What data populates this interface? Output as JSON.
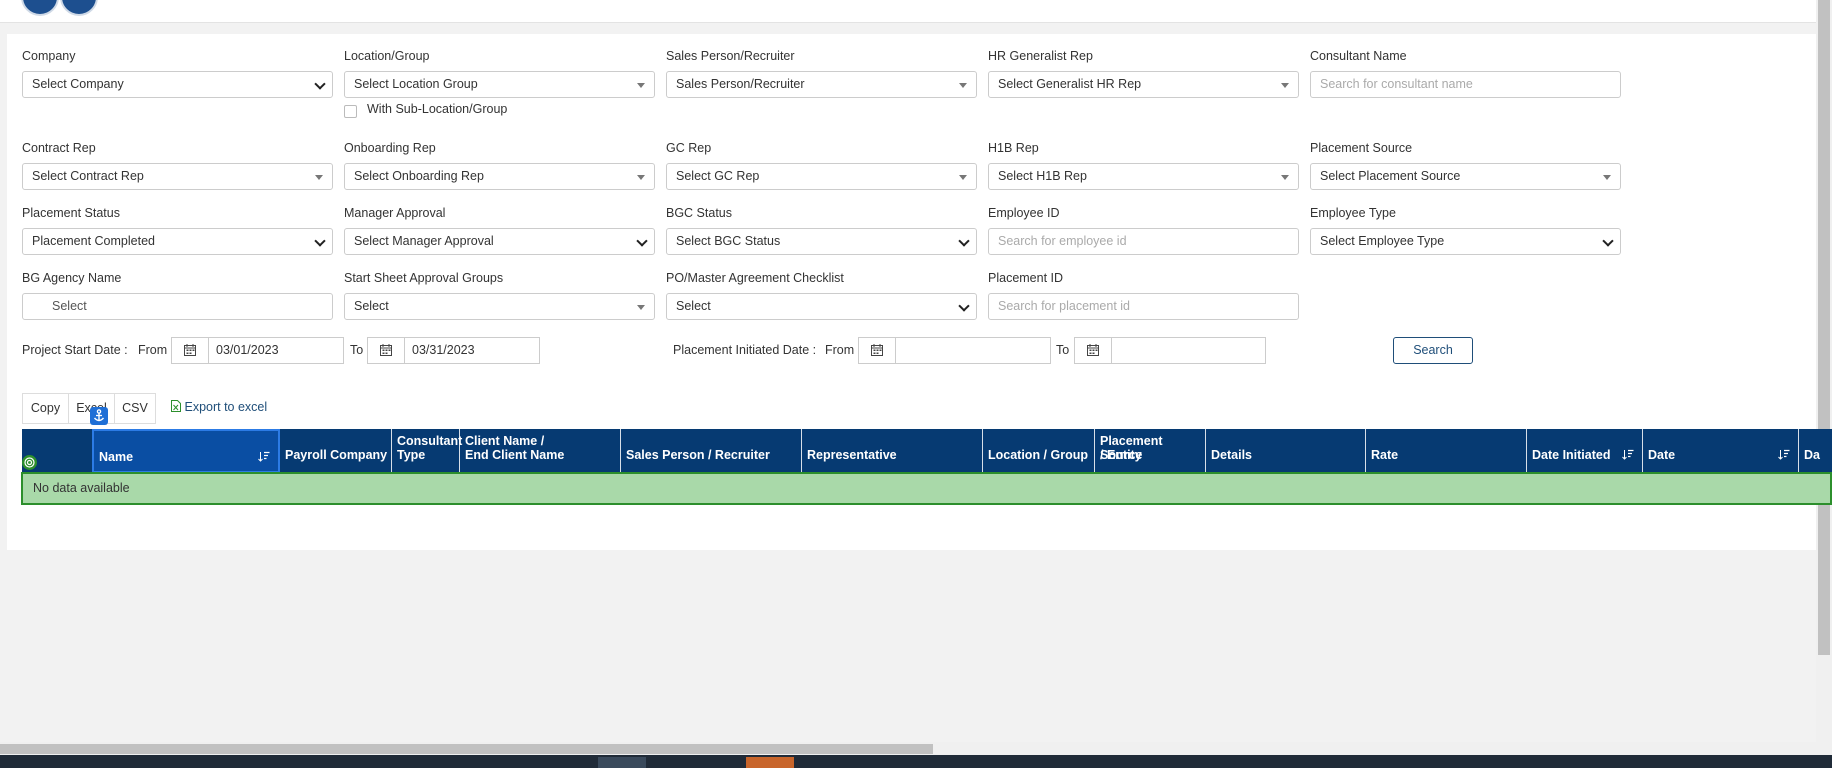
{
  "filters": {
    "company": {
      "label": "Company",
      "value": "Select Company"
    },
    "location_group": {
      "label": "Location/Group",
      "value": "Select Location Group",
      "checkbox_label": "With Sub-Location/Group"
    },
    "sales_person": {
      "label": "Sales Person/Recruiter",
      "value": "Sales Person/Recruiter"
    },
    "hr_generalist": {
      "label": "HR Generalist Rep",
      "value": "Select Generalist HR Rep"
    },
    "consultant_name": {
      "label": "Consultant Name",
      "placeholder": "Search for consultant name"
    },
    "contract_rep": {
      "label": "Contract Rep",
      "value": "Select Contract Rep"
    },
    "onboarding_rep": {
      "label": "Onboarding Rep",
      "value": "Select Onboarding Rep"
    },
    "gc_rep": {
      "label": "GC Rep",
      "value": "Select GC Rep"
    },
    "h1b_rep": {
      "label": "H1B Rep",
      "value": "Select H1B Rep"
    },
    "placement_source": {
      "label": "Placement Source",
      "value": "Select Placement Source"
    },
    "placement_status": {
      "label": "Placement Status",
      "value": "Placement Completed"
    },
    "manager_approval": {
      "label": "Manager Approval",
      "value": "Select Manager Approval"
    },
    "bgc_status": {
      "label": "BGC Status",
      "value": "Select BGC Status"
    },
    "employee_id": {
      "label": "Employee ID",
      "placeholder": "Search for employee id"
    },
    "employee_type": {
      "label": "Employee Type",
      "value": "Select Employee Type"
    },
    "bg_agency": {
      "label": "BG Agency Name",
      "value": "Select"
    },
    "start_sheet_groups": {
      "label": "Start Sheet Approval Groups",
      "value": "Select"
    },
    "po_checklist": {
      "label": "PO/Master Agreement Checklist",
      "value": "Select"
    },
    "placement_id": {
      "label": "Placement ID",
      "placeholder": "Search for placement id"
    }
  },
  "dates": {
    "project_start_label": "Project Start Date :",
    "placement_initiated_label": "Placement Initiated Date :",
    "from_label": "From",
    "to_label": "To",
    "project_from": "03/01/2023",
    "project_to": "03/31/2023",
    "placement_from": "",
    "placement_to": ""
  },
  "search_label": "Search",
  "toolbar": {
    "copy": "Copy",
    "excel": "Excel",
    "csv": "CSV",
    "export": "Export to excel"
  },
  "table": {
    "columns": [
      {
        "line1": "",
        "line2": "Name"
      },
      {
        "line1": "",
        "line2": "Payroll Company"
      },
      {
        "line1": "Consultant",
        "line2": "Type"
      },
      {
        "line1": "Client Name /",
        "line2": "End Client Name"
      },
      {
        "line1": "",
        "line2": "Sales Person / Recruiter"
      },
      {
        "line1": "",
        "line2": "Representative"
      },
      {
        "line1": "",
        "line2": "Location / Group"
      },
      {
        "line1": "Placement Source",
        "line2": "/ Entity"
      },
      {
        "line1": "",
        "line2": "Details"
      },
      {
        "line1": "",
        "line2": "Rate"
      },
      {
        "line1": "",
        "line2": "Date Initiated"
      },
      {
        "line1": "",
        "line2": "Date"
      },
      {
        "line1": "",
        "line2": "Da"
      }
    ],
    "empty_message": "No data available"
  },
  "colors": {
    "header_bg": "#063a72",
    "accent": "#1f4e79",
    "empty_row_bg": "#a9d9a9"
  }
}
